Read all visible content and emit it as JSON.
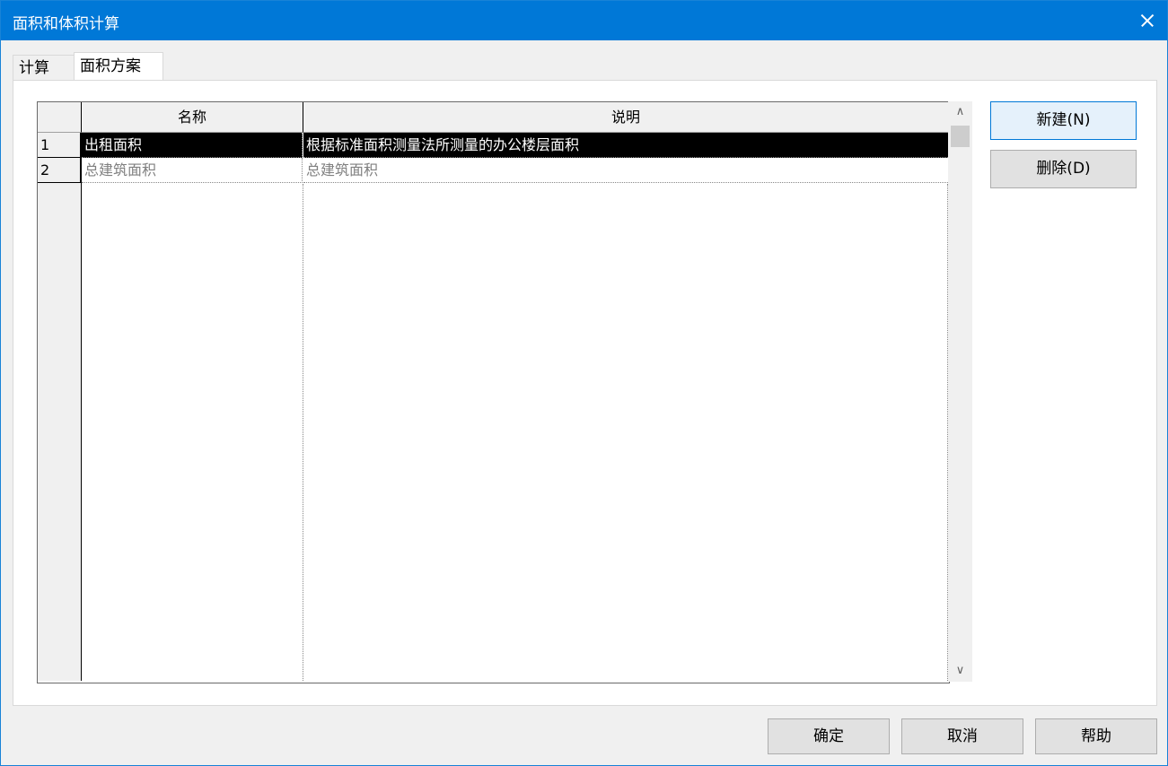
{
  "window": {
    "title": "面积和体积计算"
  },
  "tabs": [
    {
      "label": "计算"
    },
    {
      "label": "面积方案"
    }
  ],
  "grid": {
    "columns": {
      "name": "名称",
      "desc": "说明"
    },
    "rows": [
      {
        "num": "1",
        "name": "出租面积",
        "desc": "根据标准面积测量法所测量的办公楼层面积"
      },
      {
        "num": "2",
        "name": "总建筑面积",
        "desc": "总建筑面积"
      }
    ]
  },
  "side_buttons": {
    "new": "新建(N)",
    "delete": "删除(D)"
  },
  "footer": {
    "ok": "确定",
    "cancel": "取消",
    "help": "帮助"
  }
}
